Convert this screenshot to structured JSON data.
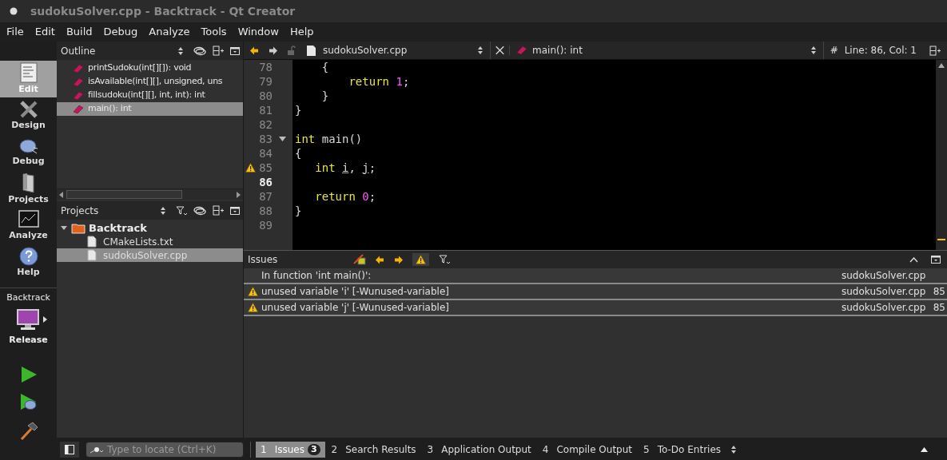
{
  "window": {
    "title": "sudokuSolver.cpp - Backtrack - Qt Creator"
  },
  "menu": [
    "File",
    "Edit",
    "Build",
    "Debug",
    "Analyze",
    "Tools",
    "Window",
    "Help"
  ],
  "modes": [
    {
      "label": "Edit",
      "kind": "edit",
      "selected": true
    },
    {
      "label": "Design",
      "kind": "design",
      "selected": false
    },
    {
      "label": "Debug",
      "kind": "debug",
      "selected": false
    },
    {
      "label": "Projects",
      "kind": "projects",
      "selected": false
    },
    {
      "label": "Analyze",
      "kind": "analyze",
      "selected": false
    },
    {
      "label": "Help",
      "kind": "help",
      "selected": false
    }
  ],
  "kit": {
    "project": "Backtrack",
    "config": "Release"
  },
  "outline": {
    "title": "Outline",
    "items": [
      {
        "label": "printSudoku(int[][]): void",
        "selected": false
      },
      {
        "label": "isAvailable(int[][], unsigned, uns",
        "selected": false
      },
      {
        "label": "fillsudoku(int[][], int, int): int",
        "selected": false
      },
      {
        "label": "main(): int",
        "selected": true
      }
    ]
  },
  "projects": {
    "title": "Projects",
    "tree": [
      {
        "label": "Backtrack",
        "kind": "folder",
        "expanded": true,
        "selected": false,
        "children": [
          {
            "label": "CMakeLists.txt",
            "kind": "file",
            "selected": false
          },
          {
            "label": "sudokuSolver.cpp",
            "kind": "file",
            "selected": true
          }
        ]
      }
    ]
  },
  "editor": {
    "file": "sudokuSolver.cpp",
    "symbol": "main(): int",
    "hash": "#",
    "position": "Line: 86, Col: 1",
    "lines": [
      {
        "number": "78",
        "current": false,
        "warning": false,
        "foldable": false,
        "tokens": [
          {
            "text": "    {",
            "kind": "plain"
          }
        ]
      },
      {
        "number": "79",
        "current": false,
        "warning": false,
        "foldable": false,
        "tokens": [
          {
            "text": "        return ",
            "kind": "keyword"
          },
          {
            "text": "1",
            "kind": "number"
          },
          {
            "text": ";",
            "kind": "plain"
          }
        ]
      },
      {
        "number": "80",
        "current": false,
        "warning": false,
        "foldable": false,
        "tokens": [
          {
            "text": "    }",
            "kind": "plain"
          }
        ]
      },
      {
        "number": "81",
        "current": false,
        "warning": false,
        "foldable": false,
        "tokens": [
          {
            "text": "}",
            "kind": "plain"
          }
        ]
      },
      {
        "number": "82",
        "current": false,
        "warning": false,
        "foldable": false
      },
      {
        "number": "83",
        "current": false,
        "warning": false,
        "foldable": true,
        "tokens": [
          {
            "text": "int",
            "kind": "keyword"
          },
          {
            "text": " main()",
            "kind": "plain"
          }
        ]
      },
      {
        "number": "84",
        "current": false,
        "warning": false,
        "foldable": false,
        "tokens": [
          {
            "text": "{",
            "kind": "plain"
          }
        ]
      },
      {
        "number": "85",
        "current": false,
        "warning": true,
        "foldable": false,
        "tokens": [
          {
            "text": "   int ",
            "kind": "keyword"
          },
          {
            "text": "i",
            "kind": "unused"
          },
          {
            "text": ", ",
            "kind": "plain"
          },
          {
            "text": "j",
            "kind": "unused"
          },
          {
            "text": ";",
            "kind": "plain"
          }
        ]
      },
      {
        "number": "86",
        "current": true,
        "warning": false,
        "foldable": false
      },
      {
        "number": "87",
        "current": false,
        "warning": false,
        "foldable": false,
        "tokens": [
          {
            "text": "   return ",
            "kind": "keyword"
          },
          {
            "text": "0",
            "kind": "number"
          },
          {
            "text": ";",
            "kind": "plain"
          }
        ]
      },
      {
        "number": "88",
        "current": false,
        "warning": false,
        "foldable": false,
        "tokens": [
          {
            "text": "}",
            "kind": "plain"
          }
        ]
      },
      {
        "number": "89",
        "current": false,
        "warning": false,
        "foldable": false
      }
    ]
  },
  "issues": {
    "title": "Issues",
    "rows": [
      {
        "kind": "heading",
        "text": "In function 'int main()':",
        "file": "sudokuSolver.cpp"
      },
      {
        "kind": "warning",
        "text": "unused variable 'i' [-Wunused-variable]",
        "file": "sudokuSolver.cpp",
        "line": "85"
      },
      {
        "kind": "warning",
        "text": "unused variable 'j' [-Wunused-variable]",
        "file": "sudokuSolver.cpp",
        "line": "85"
      }
    ]
  },
  "bottom": {
    "locate": {
      "placeholder": "Type to locate (Ctrl+K)"
    },
    "tabs": [
      {
        "number": "1",
        "label": "Issues",
        "count": "3",
        "selected": true
      },
      {
        "number": "2",
        "label": "Search Results",
        "selected": false
      },
      {
        "number": "3",
        "label": "Application Output",
        "selected": false
      },
      {
        "number": "4",
        "label": "Compile Output",
        "selected": false
      },
      {
        "number": "5",
        "label": "To-Do Entries",
        "selected": false
      }
    ]
  }
}
